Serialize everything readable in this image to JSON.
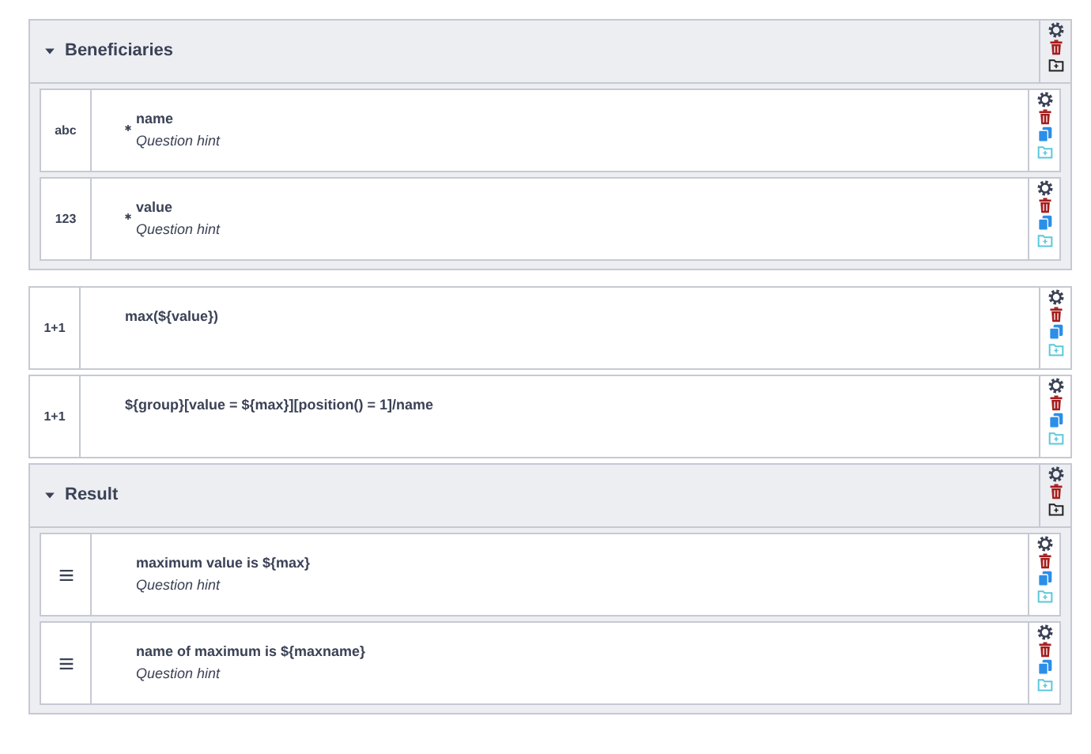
{
  "items": [
    {
      "kind": "group",
      "title": "Beneficiaries",
      "expanded": true,
      "children": [
        {
          "kind": "text",
          "type_label": "abc",
          "required": true,
          "title": "name",
          "hint": "Question hint"
        },
        {
          "kind": "integer",
          "type_label": "123",
          "required": true,
          "title": "value",
          "hint": "Question hint"
        }
      ]
    },
    {
      "kind": "calculate",
      "type_label": "1+1",
      "required": false,
      "title": "max(${value})"
    },
    {
      "kind": "calculate",
      "type_label": "1+1",
      "required": false,
      "title": "${group}[value = ${max}][position() = 1]/name"
    },
    {
      "kind": "group",
      "title": "Result",
      "expanded": true,
      "children": [
        {
          "kind": "note",
          "required": false,
          "title": "maximum value is ${max}",
          "hint": "Question hint"
        },
        {
          "kind": "note",
          "required": false,
          "title": "name of maximum is ${maxname}",
          "hint": "Question hint"
        }
      ]
    }
  ]
}
